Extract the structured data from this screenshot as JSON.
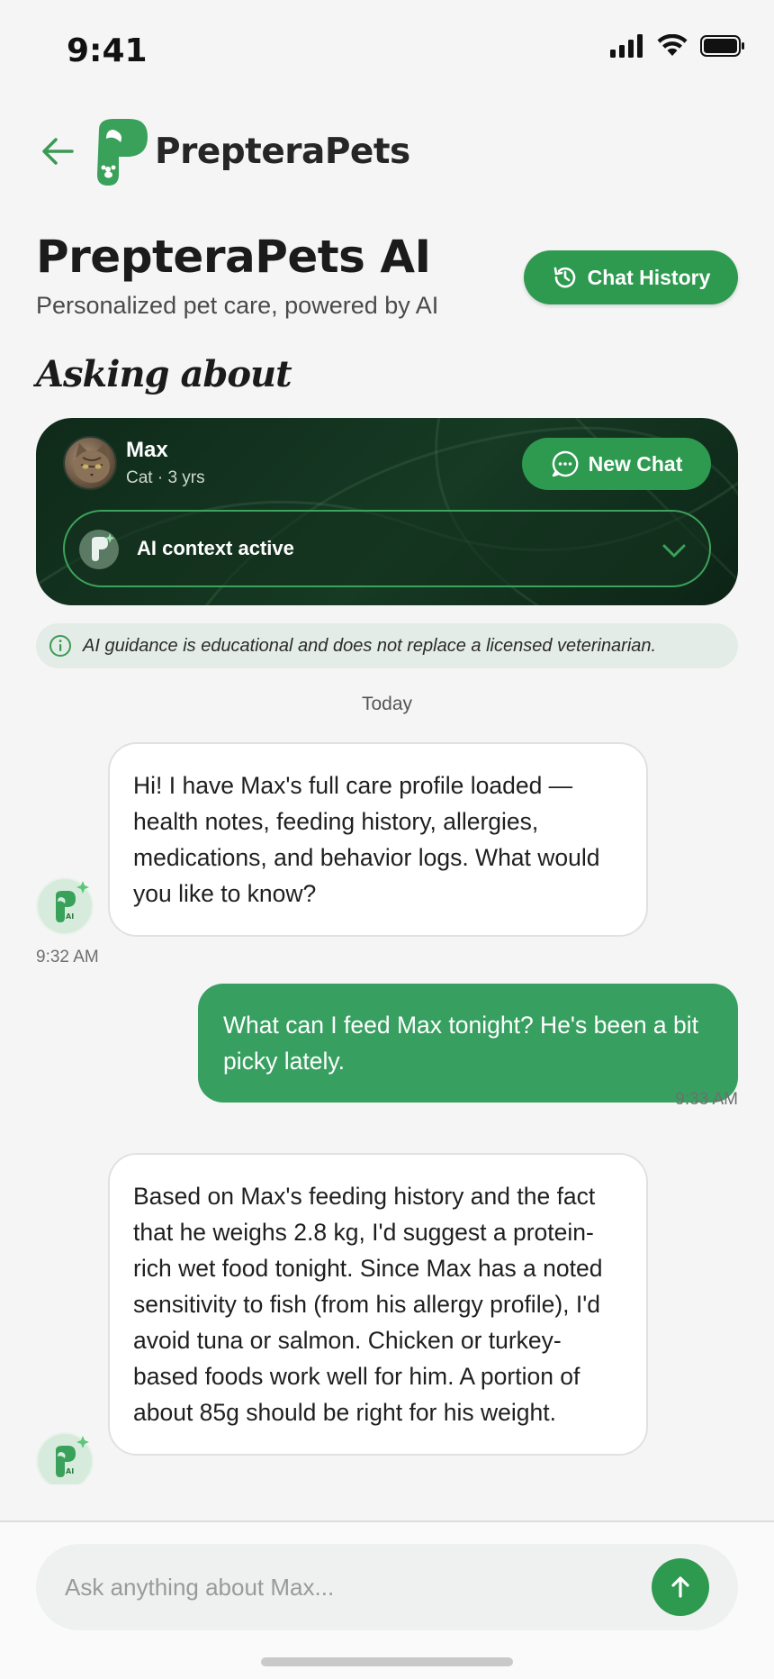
{
  "status_bar": {
    "time": "9:41"
  },
  "header": {
    "brand": "PrepteraPets",
    "logo_mark_text": "AI"
  },
  "page": {
    "title": "PrepteraPets AI",
    "subtitle": "Personalized pet care, powered by AI",
    "history_button": "Chat History",
    "asking_about_label": "Asking about"
  },
  "pet_card": {
    "name": "Max",
    "meta": "Cat · 3 yrs",
    "new_chat_button": "New Chat",
    "context_label": "AI context active"
  },
  "disclaimer": "AI guidance is educational and does not replace a licensed veterinarian.",
  "chat": {
    "date_label": "Today",
    "messages": [
      {
        "sender": "ai",
        "text": "Hi! I have Max's full care profile loaded — health notes, feeding history, allergies, medications, and behavior logs. What would you like to know?",
        "time": "9:32 AM"
      },
      {
        "sender": "user",
        "text": "What can I feed Max tonight? He's been a bit picky lately.",
        "time": "9:33 AM"
      },
      {
        "sender": "ai",
        "text": "Based on Max's feeding history and the fact that he weighs 2.8 kg, I'd suggest a protein-rich wet food tonight. Since Max has a noted sensitivity to fish (from his allergy profile), I'd avoid tuna or salmon. Chicken or turkey-based foods work well for him. A portion of about 85g should be right for his weight."
      }
    ]
  },
  "composer": {
    "placeholder": "Ask anything about Max..."
  },
  "colors": {
    "accent": "#2e9a4f",
    "user_bubble": "#37a060",
    "card_dark": "#12301d"
  }
}
